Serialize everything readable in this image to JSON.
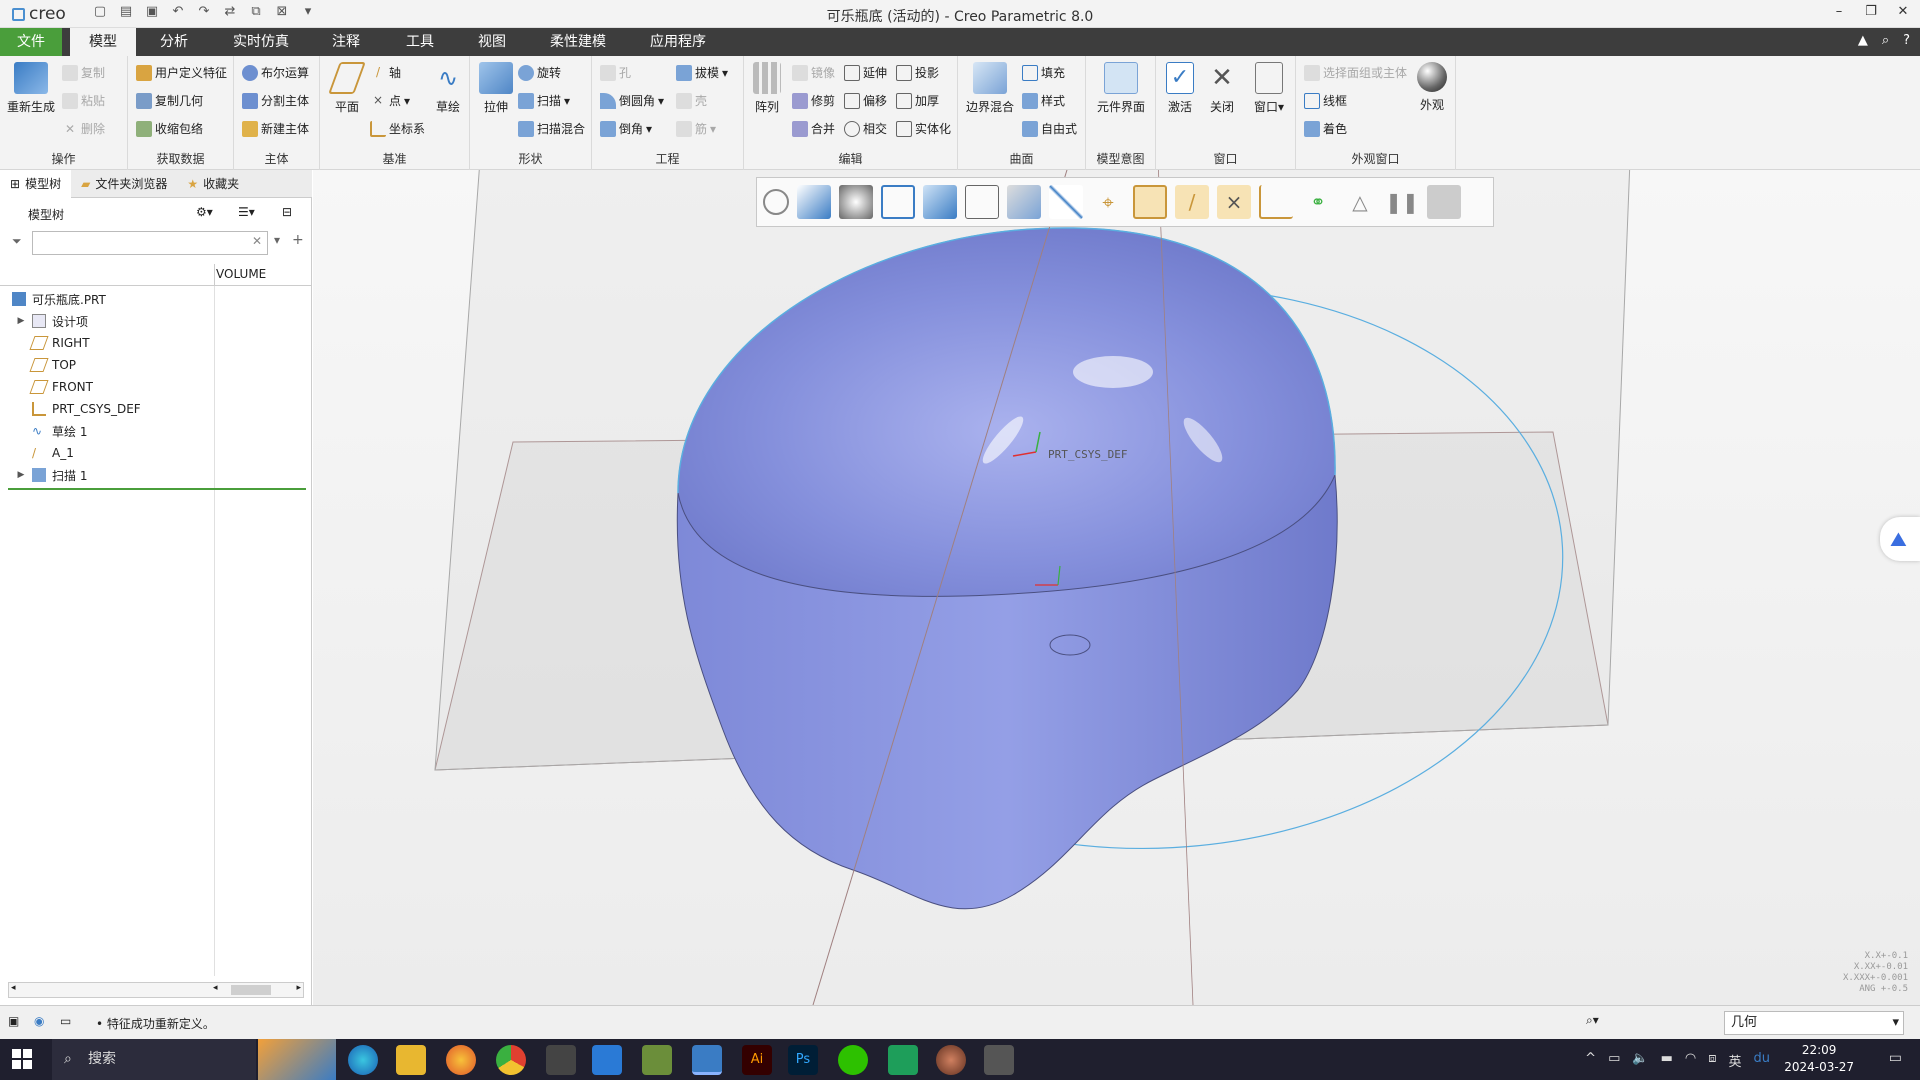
{
  "window": {
    "app_logo": "creo",
    "title": "可乐瓶底 (活动的) - Creo Parametric 8.0"
  },
  "menu": {
    "tabs": [
      "文件",
      "模型",
      "分析",
      "实时仿真",
      "注释",
      "工具",
      "视图",
      "柔性建模",
      "应用程序"
    ],
    "active": "模型"
  },
  "ribbon": {
    "operations": {
      "regenerate": "重新生成",
      "copy": "复制",
      "paste": "粘贴",
      "delete": "删除",
      "label": "操作"
    },
    "get_data": {
      "udf": "用户定义特征",
      "copy_geom": "复制几何",
      "shrinkwrap": "收缩包络",
      "label": "获取数据"
    },
    "body": {
      "boolean": "布尔运算",
      "split": "分割主体",
      "new_body": "新建主体",
      "label": "主体"
    },
    "datum": {
      "plane": "平面",
      "axis": "轴",
      "point": "点",
      "csys": "坐标系",
      "sketch": "草绘",
      "label": "基准"
    },
    "shapes": {
      "extrude": "拉伸",
      "revolve": "旋转",
      "sweep": "扫描",
      "swept_blend": "扫描混合",
      "label": "形状"
    },
    "engineering": {
      "hole": "孔",
      "round": "倒圆角",
      "chamfer": "倒角",
      "draft": "拔模",
      "shell": "壳",
      "rib": "筋",
      "label": "工程"
    },
    "editing": {
      "pattern": "阵列",
      "mirror": "镜像",
      "trim": "修剪",
      "merge": "合并",
      "extend": "延伸",
      "offset": "偏移",
      "intersect": "相交",
      "project": "投影",
      "thicken": "加厚",
      "solidify": "实体化",
      "label": "编辑"
    },
    "surfaces": {
      "boundary_blend": "边界混合",
      "fill": "填充",
      "style": "样式",
      "freestyle": "自由式",
      "label": "曲面"
    },
    "model_intent": {
      "component_interface": "元件界面",
      "label": "模型意图"
    },
    "window_group": {
      "activate": "激活",
      "close": "关闭",
      "windows": "窗口",
      "label": "窗口"
    },
    "appearance": {
      "select_face": "选择面组或主体",
      "wireframe": "线框",
      "shading": "着色",
      "appearance": "外观",
      "label": "外观窗口"
    }
  },
  "left_panel": {
    "tabs": [
      "模型树",
      "文件夹浏览器",
      "收藏夹"
    ],
    "tree_label": "模型树",
    "column": "VOLUME",
    "items": [
      {
        "label": "可乐瓶底.PRT",
        "expand": ""
      },
      {
        "label": "设计项",
        "expand": "▶"
      },
      {
        "label": "RIGHT",
        "expand": ""
      },
      {
        "label": "TOP",
        "expand": ""
      },
      {
        "label": "FRONT",
        "expand": ""
      },
      {
        "label": "PRT_CSYS_DEF",
        "expand": ""
      },
      {
        "label": "草绘 1",
        "expand": ""
      },
      {
        "label": "A_1",
        "expand": ""
      },
      {
        "label": "扫描 1",
        "expand": "▶"
      }
    ]
  },
  "viewport": {
    "csys_label": "PRT_CSYS_DEF",
    "readout": [
      "X.X+-0.1",
      "X.XX+-0.01",
      "X.XXX+-0.001",
      "ANG +-0.5"
    ],
    "colors": {
      "body": "#8590dc",
      "edge": "#5aaee0",
      "plane": "#a08080"
    }
  },
  "status": {
    "message": "• 特征成功重新定义。",
    "filter_value": "几何"
  },
  "taskbar": {
    "search": "搜索",
    "time": "22:09",
    "date": "2024-03-27",
    "ime": "英"
  }
}
